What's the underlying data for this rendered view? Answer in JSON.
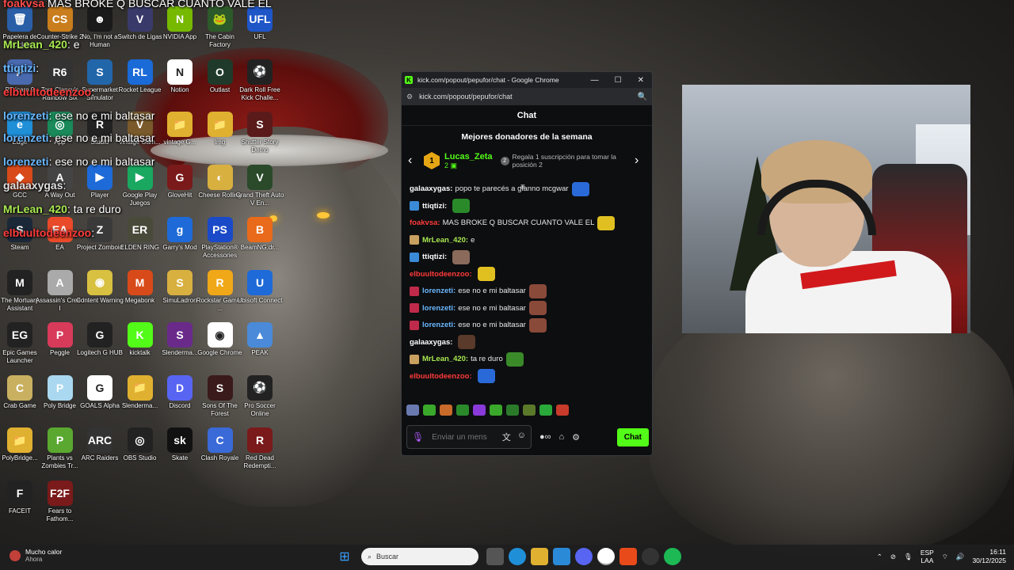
{
  "desktop": {
    "icons": [
      {
        "label": "Papelera de reciclaje",
        "color": "#2a5fa8",
        "glyph": "🗑"
      },
      {
        "label": "Counter-Strike 2",
        "color": "#c97d1c",
        "glyph": "CS"
      },
      {
        "label": "No, I'm not a Human",
        "color": "#1a1a1a",
        "glyph": "☻"
      },
      {
        "label": "Switch de Ligas",
        "color": "#3a3a6a",
        "glyph": "V"
      },
      {
        "label": "NVIDIA App",
        "color": "#76b900",
        "glyph": "N"
      },
      {
        "label": "The Cabin Factory",
        "color": "#2d5a2a",
        "glyph": "🐸"
      },
      {
        "label": "UFL",
        "color": "#1e56c8",
        "glyph": "UFL"
      },
      {
        "label": "PT Icaro 9",
        "color": "#4a6ab0",
        "glyph": "P"
      },
      {
        "label": "Tom Clancy's Rainbow Six",
        "color": "#333",
        "glyph": "R6"
      },
      {
        "label": "Supermarket Simulator",
        "color": "#2266aa",
        "glyph": "S"
      },
      {
        "label": "Rocket League",
        "color": "#1a6ad8",
        "glyph": "RL"
      },
      {
        "label": "Notion",
        "color": "#ffffff",
        "glyph": "N"
      },
      {
        "label": "Outlast",
        "color": "#1f3a2a",
        "glyph": "O"
      },
      {
        "label": "Dark Roll Free Kick Challe...",
        "color": "#222",
        "glyph": "⚽"
      },
      {
        "label": "Edge",
        "color": "#1f8fd8",
        "glyph": "e"
      },
      {
        "label": "App",
        "color": "#1a8a5a",
        "glyph": "◎"
      },
      {
        "label": "Studio",
        "color": "#222",
        "glyph": "R"
      },
      {
        "label": "vintage Gam...",
        "color": "#7a5a2a",
        "glyph": "V"
      },
      {
        "label": "vintage G...",
        "color": "#e0b030",
        "glyph": "📁"
      },
      {
        "label": "Img",
        "color": "#e0b030",
        "glyph": "📁"
      },
      {
        "label": "Shutter Story Demo",
        "color": "#5a1a1a",
        "glyph": "S"
      },
      {
        "label": "GCC",
        "color": "#d84a1a",
        "glyph": "◆"
      },
      {
        "label": "A Way Out",
        "color": "#444",
        "glyph": "A"
      },
      {
        "label": "Player",
        "color": "#1e6ad8",
        "glyph": "▶"
      },
      {
        "label": "Google Play Juegos",
        "color": "#1aa860",
        "glyph": "▶"
      },
      {
        "label": "GloveHit",
        "color": "#7a1a1a",
        "glyph": "G"
      },
      {
        "label": "Cheese Rolling",
        "color": "#d8b040",
        "glyph": "◐"
      },
      {
        "label": "Grand Theft Auto V En...",
        "color": "#2a4a2a",
        "glyph": "V"
      },
      {
        "label": "Steam",
        "color": "#1b2838",
        "glyph": "S"
      },
      {
        "label": "EA",
        "color": "#e84a2a",
        "glyph": "EA"
      },
      {
        "label": "Project Zomboid",
        "color": "#3a3a3a",
        "glyph": "Z"
      },
      {
        "label": "ELDEN RING",
        "color": "#4a4a3a",
        "glyph": "ER"
      },
      {
        "label": "Garry's Mod",
        "color": "#1e6ad8",
        "glyph": "g"
      },
      {
        "label": "PlayStation® Accessories",
        "color": "#1a4ac8",
        "glyph": "PS"
      },
      {
        "label": "BeamNG.dr...",
        "color": "#e86a1a",
        "glyph": "B"
      },
      {
        "label": "The Mortuary Assistant",
        "color": "#222",
        "glyph": "M"
      },
      {
        "label": "Assassin's Creed I",
        "color": "#aaa",
        "glyph": "A"
      },
      {
        "label": "Content Warning",
        "color": "#d8c040",
        "glyph": "◉"
      },
      {
        "label": "Megabonk",
        "color": "#d84a1a",
        "glyph": "M"
      },
      {
        "label": "SimuLadron",
        "color": "#d8b040",
        "glyph": "S"
      },
      {
        "label": "Rockstar Games ...",
        "color": "#f0a818",
        "glyph": "R"
      },
      {
        "label": "Ubisoft Connect",
        "color": "#1e6ad8",
        "glyph": "U"
      },
      {
        "label": "Epic Games Launcher",
        "color": "#222",
        "glyph": "EG"
      },
      {
        "label": "Peggle",
        "color": "#d83a5a",
        "glyph": "P"
      },
      {
        "label": "Logitech G HUB",
        "color": "#222",
        "glyph": "G"
      },
      {
        "label": "kicktalk",
        "color": "#53fc18",
        "glyph": "K"
      },
      {
        "label": "Slenderma...",
        "color": "#6a2a8a",
        "glyph": "S"
      },
      {
        "label": "Google Chrome",
        "color": "#ffffff",
        "glyph": "◉"
      },
      {
        "label": "PEAK",
        "color": "#4a8ad8",
        "glyph": "▲"
      },
      {
        "label": "Crab Game",
        "color": "#c8b060",
        "glyph": "C"
      },
      {
        "label": "Poly Bridge",
        "color": "#aad8f0",
        "glyph": "P"
      },
      {
        "label": "GOALS Alpha",
        "color": "#ffffff",
        "glyph": "G"
      },
      {
        "label": "Slenderma...",
        "color": "#e0b030",
        "glyph": "📁"
      },
      {
        "label": "Discord",
        "color": "#5865f2",
        "glyph": "D"
      },
      {
        "label": "Sons Of The Forest",
        "color": "#3a1a1a",
        "glyph": "S"
      },
      {
        "label": "Pro Soccer Online",
        "color": "#222",
        "glyph": "⚽"
      },
      {
        "label": "PolyBridge...",
        "color": "#e0b030",
        "glyph": "📁"
      },
      {
        "label": "Plants vs Zombies Tr...",
        "color": "#5aa830",
        "glyph": "P"
      },
      {
        "label": "ARC Raiders",
        "color": "#333",
        "glyph": "ARC"
      },
      {
        "label": "OBS Studio",
        "color": "#222",
        "glyph": "◎"
      },
      {
        "label": "Skate",
        "color": "#111",
        "glyph": "sk"
      },
      {
        "label": "Clash Royale",
        "color": "#3a6ad8",
        "glyph": "C"
      },
      {
        "label": "Red Dead Redempti...",
        "color": "#7a1a1a",
        "glyph": "R"
      },
      {
        "label": "FACEIT",
        "color": "#222",
        "glyph": "F"
      },
      {
        "label": "Fears to Fathom...",
        "color": "#7a1a1a",
        "glyph": "F2F"
      }
    ]
  },
  "overlay_chat": [
    {
      "user": "foakvsa",
      "text": " MAS BROKE Q BUSCAR CUANTO VALE EL",
      "color": "#ff4a4a"
    },
    {
      "user": "MrLean_420",
      "text": ": e",
      "color": "#a8e850"
    },
    {
      "user": "ttiqtizi",
      "text": ":",
      "color": "#6ab8ff"
    },
    {
      "user": "elbuultodeenzoo",
      "text": ":",
      "color": "#ff3a3a"
    },
    {
      "user": "lorenzeti",
      "text": ": ese no e mi baltasar",
      "color": "#6ab8ff"
    },
    {
      "user": "lorenzeti",
      "text": ": ese no e mi baltasar",
      "color": "#6ab8ff"
    },
    {
      "user": "lorenzeti",
      "text": ": ese no e mi baltasar",
      "color": "#6ab8ff"
    },
    {
      "user": "galaaxygas",
      "text": ":",
      "color": "#e0e0e0"
    },
    {
      "user": "MrLean_420",
      "text": ": ta re duro",
      "color": "#a8e850"
    },
    {
      "user": "elbuultodeenzoo",
      "text": ":",
      "color": "#ff3a3a"
    }
  ],
  "browser": {
    "title": "kick.com/popout/pepufor/chat - Google Chrome",
    "url": "kick.com/popout/pepufor/chat",
    "controls": {
      "minimize": "—",
      "maximize": "☐",
      "close": "✕"
    }
  },
  "chat": {
    "header": "Chat",
    "donors_title": "Mejores donadores de la semana",
    "top_donor": {
      "rank": "1",
      "name": "Lucas_Zeta",
      "count": "2"
    },
    "gift": {
      "rank": "2",
      "text": "Regala 1 suscripción para tomar la posición 2"
    },
    "messages": [
      {
        "user": "galaaxygas:",
        "text": "popo te parecés a gianno mcgwar",
        "color": "#ffffff",
        "badge": "",
        "emote": "#2a6ad8"
      },
      {
        "user": "ttiqtizi:",
        "text": "",
        "color": "#ffffff",
        "badge": "#3a8ad8",
        "emote": "#2a8a2a"
      },
      {
        "user": "foakvsa:",
        "text": "MAS BROKE Q BUSCAR CUANTO VALE EL",
        "color": "#ff3a3a",
        "badge": "",
        "emote": "#e0c020"
      },
      {
        "user": "MrLean_420:",
        "text": "e",
        "color": "#a8e850",
        "badge": "#c8a060",
        "emote": ""
      },
      {
        "user": "ttiqtizi:",
        "text": "",
        "color": "#ffffff",
        "badge": "#3a8ad8",
        "emote": "#8a6a5a"
      },
      {
        "user": "elbuultodeenzoo:",
        "text": "",
        "color": "#ff3a3a",
        "badge": "",
        "emote": "#e0c020"
      },
      {
        "user": "lorenzeti:",
        "text": "ese no e mi baltasar",
        "color": "#6ab8ff",
        "badge": "#c02a4a",
        "emote": "#8a4a3a"
      },
      {
        "user": "lorenzeti:",
        "text": "ese no e mi baltasar",
        "color": "#6ab8ff",
        "badge": "#c02a4a",
        "emote": "#8a4a3a"
      },
      {
        "user": "lorenzeti:",
        "text": "ese no e mi baltasar",
        "color": "#6ab8ff",
        "badge": "#c02a4a",
        "emote": "#8a4a3a"
      },
      {
        "user": "galaaxygas:",
        "text": "",
        "color": "#ffffff",
        "badge": "",
        "emote": "#5a3a2a"
      },
      {
        "user": "MrLean_420:",
        "text": "ta re duro",
        "color": "#a8e850",
        "badge": "#c8a060",
        "emote": "#3a8a2a"
      },
      {
        "user": "elbuultodeenzoo:",
        "text": "",
        "color": "#ff3a3a",
        "badge": "",
        "emote": "#2a6ad8"
      }
    ],
    "input_placeholder": "Enviar un mensaje",
    "send_label": "Chat",
    "accent": "#53fc18"
  },
  "taskbar": {
    "weather_title": "Mucho calor",
    "weather_sub": "Ahora",
    "search_placeholder": "Buscar",
    "lang_top": "ESP",
    "lang_bottom": "LAA",
    "time": "16:11",
    "date": "30/12/2025"
  }
}
